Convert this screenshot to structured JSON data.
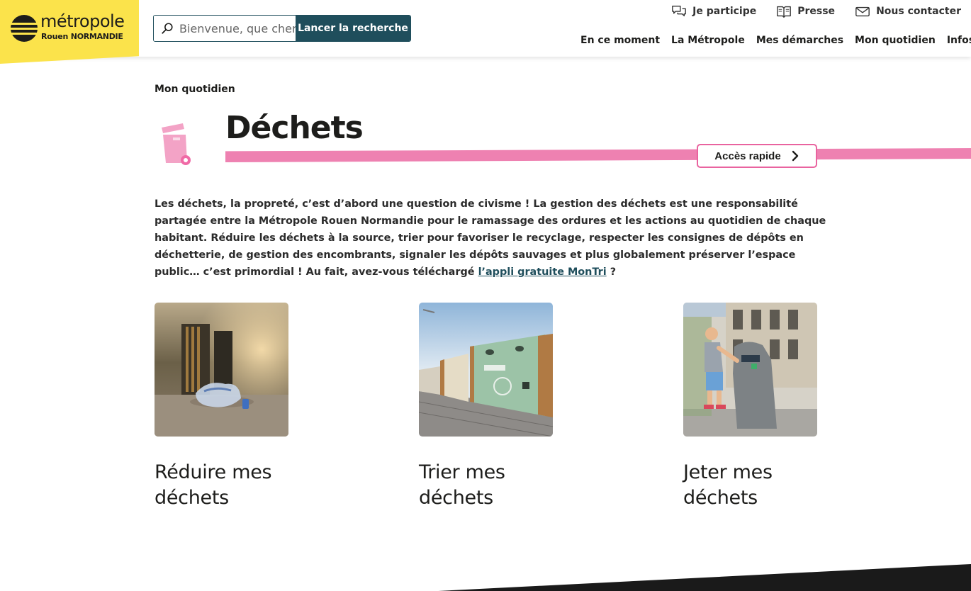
{
  "brand": {
    "title": "métropole",
    "subtitle_city": "Rouen",
    "subtitle_region": "NORMANDIE",
    "colors": {
      "yellow": "#fbe34b",
      "teal": "#1f4e5c",
      "pink": "#ee81b1"
    }
  },
  "search": {
    "placeholder": "Bienvenue, que cherchez-vous ?",
    "button_label": "Lancer la recherche"
  },
  "utility_nav": [
    {
      "label": "Je participe",
      "icon": "chat-bubbles-icon"
    },
    {
      "label": "Presse",
      "icon": "open-book-icon"
    },
    {
      "label": "Nous contacter",
      "icon": "envelope-icon"
    }
  ],
  "main_nav": [
    "En ce moment",
    "La Métropole",
    "Mes démarches",
    "Mon quotidien",
    "Infos pro"
  ],
  "breadcrumb": "Mon quotidien",
  "page": {
    "title": "Déchets",
    "title_icon": "waste-bin-icon",
    "quick_access_label": "Accès rapide"
  },
  "intro": {
    "text_before": " Les déchets, la propreté, c’est d’abord une question de civisme ! La gestion des déchets est une responsabilité partagée entre la Métropole Rouen Normandie pour le ramassage des ordures et les actions au quotidien de chaque habitant. Réduire les déchets à la source, trier pour favoriser le recyclage, respecter les consignes de dépôts en déchetterie, de gestion des encombrants, signaler les dépôts sauvages et plus globalement préserver l’espace public… c’est primordial ! Au fait, avez-vous téléchargé ",
    "link_text": "l’appli gratuite MonTri",
    "text_after": " ?"
  },
  "cards": [
    {
      "title": "Réduire mes déchets"
    },
    {
      "title": "Trier mes déchets"
    },
    {
      "title": "Jeter mes déchets"
    }
  ]
}
